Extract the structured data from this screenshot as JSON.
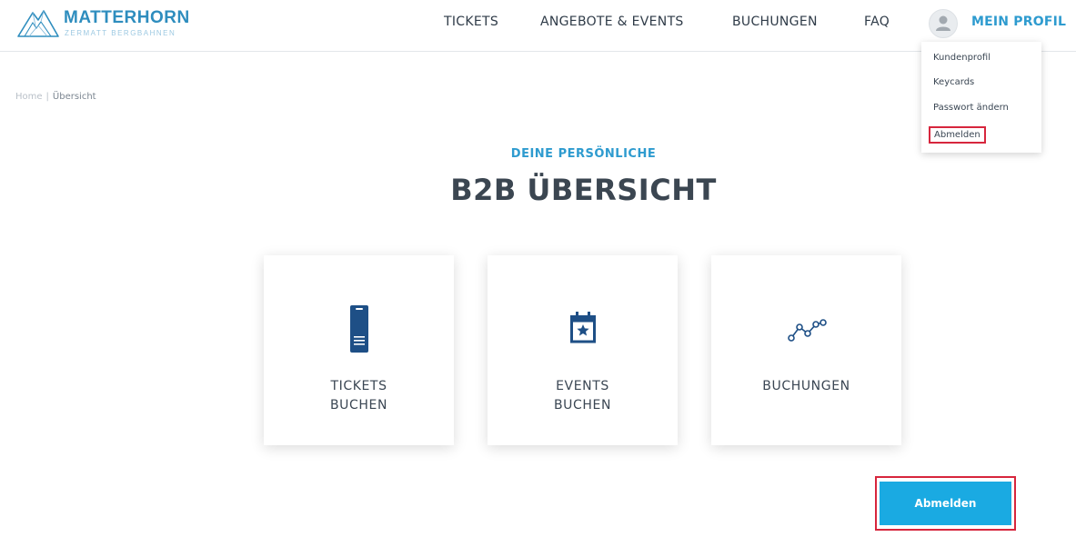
{
  "brand": {
    "name": "MATTERHORN",
    "tagline": "ZERMATT BERGBAHNEN"
  },
  "nav": {
    "items": [
      {
        "label": "TICKETS"
      },
      {
        "label": "ANGEBOTE & EVENTS"
      },
      {
        "label": "BUCHUNGEN"
      },
      {
        "label": "FAQ"
      }
    ],
    "profile_label": "MEIN PROFIL"
  },
  "profile_menu": {
    "items": [
      {
        "label": "Kundenprofil"
      },
      {
        "label": "Keycards"
      },
      {
        "label": "Passwort ändern"
      },
      {
        "label": "Abmelden"
      }
    ]
  },
  "breadcrumb": {
    "home": "Home",
    "separator": "|",
    "current": "Übersicht"
  },
  "page": {
    "subtitle": "DEINE PERSÖNLICHE",
    "title": "B2B ÜBERSICHT"
  },
  "cards": [
    {
      "line1": "TICKETS",
      "line2": "BUCHEN",
      "icon": "ticket-icon"
    },
    {
      "line1": "EVENTS",
      "line2": "BUCHEN",
      "icon": "calendar-star-icon"
    },
    {
      "line1": "BUCHUNGEN",
      "line2": "",
      "icon": "bookings-route-icon"
    }
  ],
  "logout_button": {
    "label": "Abmelden"
  },
  "colors": {
    "accent": "#2e9bcf",
    "button": "#1aaae2",
    "icon": "#1e4f86",
    "highlight": "#d7263d",
    "text": "#3b4651"
  }
}
